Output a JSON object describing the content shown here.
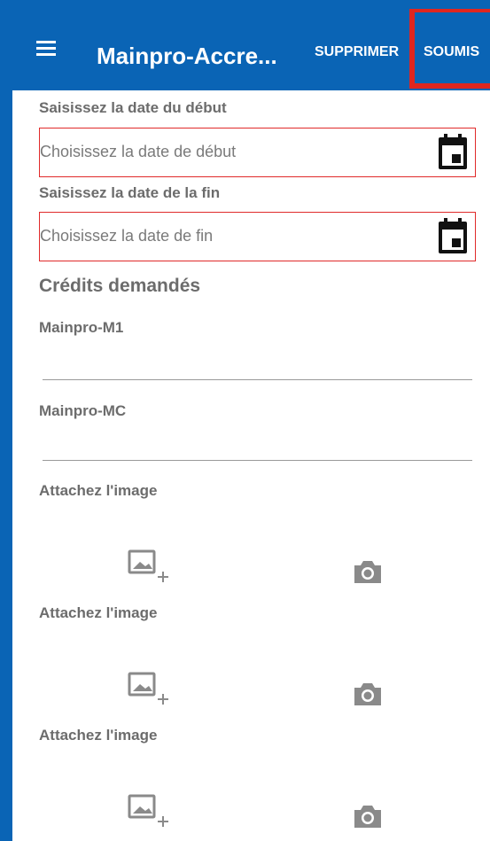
{
  "toolbar": {
    "title": "Mainpro-Accre...",
    "delete_label": "SUPPRIMER",
    "submit_label": "SOUMIS",
    "menu_icon": "hamburger-menu-icon",
    "color": "#0a64b5",
    "highlight_color": "#e0261f"
  },
  "form": {
    "start_date": {
      "label": "Saisissez la date du début",
      "placeholder": "Choisissez la date de début",
      "icon": "calendar-icon"
    },
    "end_date": {
      "label": "Saisissez la date de la fin",
      "placeholder": "Choisissez la date de fin",
      "icon": "calendar-icon"
    },
    "credits": {
      "title": "Crédits demandés",
      "m1_label": "Mainpro-M1",
      "m1_value": "",
      "mc_label": "Mainpro-MC",
      "mc_value": ""
    },
    "attachments": [
      {
        "label": "Attachez l'image",
        "gallery_icon": "add-image-icon",
        "camera_icon": "camera-icon"
      },
      {
        "label": "Attachez l'image",
        "gallery_icon": "add-image-icon",
        "camera_icon": "camera-icon"
      },
      {
        "label": "Attachez l'image",
        "gallery_icon": "add-image-icon",
        "camera_icon": "camera-icon"
      }
    ]
  },
  "colors": {
    "error_border": "#e02a2a",
    "label_text": "#6c6c6c"
  }
}
